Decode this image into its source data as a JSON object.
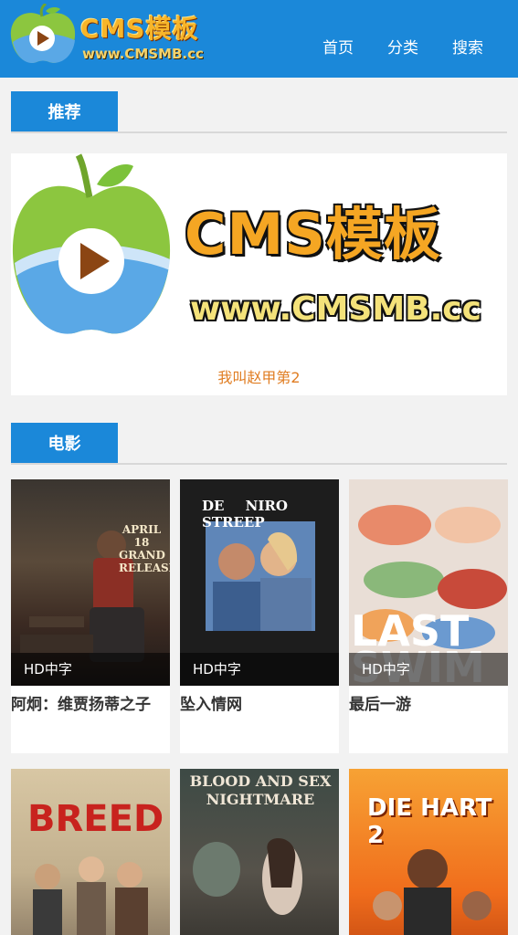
{
  "header": {
    "logo_text": "CMS模板",
    "logo_url": "www.CMSMB.cc",
    "nav": [
      "首页",
      "分类",
      "搜索"
    ]
  },
  "sections": {
    "recommend": "推荐",
    "movies": "电影"
  },
  "banner": {
    "title": "CMS模板",
    "url": "www.CMSMB.cc",
    "caption": "我叫赵甲第2"
  },
  "movies": [
    {
      "title": "阿炯：维贾扬蒂之子",
      "badge": "HD中字",
      "poster_text": "APRIL 18 GRAND RELEASE"
    },
    {
      "title": "坠入情网",
      "badge": "HD中字",
      "poster_text": "DE NIRO STREEP"
    },
    {
      "title": "最后一游",
      "badge": "HD中字",
      "poster_text": "LAST SWIM"
    },
    {
      "title": "",
      "badge": "",
      "poster_text": "BREED"
    },
    {
      "title": "",
      "badge": "",
      "poster_text": "BLOOD AND SEX NIGHTMARE"
    },
    {
      "title": "",
      "badge": "",
      "poster_text": "DIE HART 2"
    }
  ],
  "colors": {
    "brand": "#1b88d9",
    "caption": "#e07d22"
  }
}
